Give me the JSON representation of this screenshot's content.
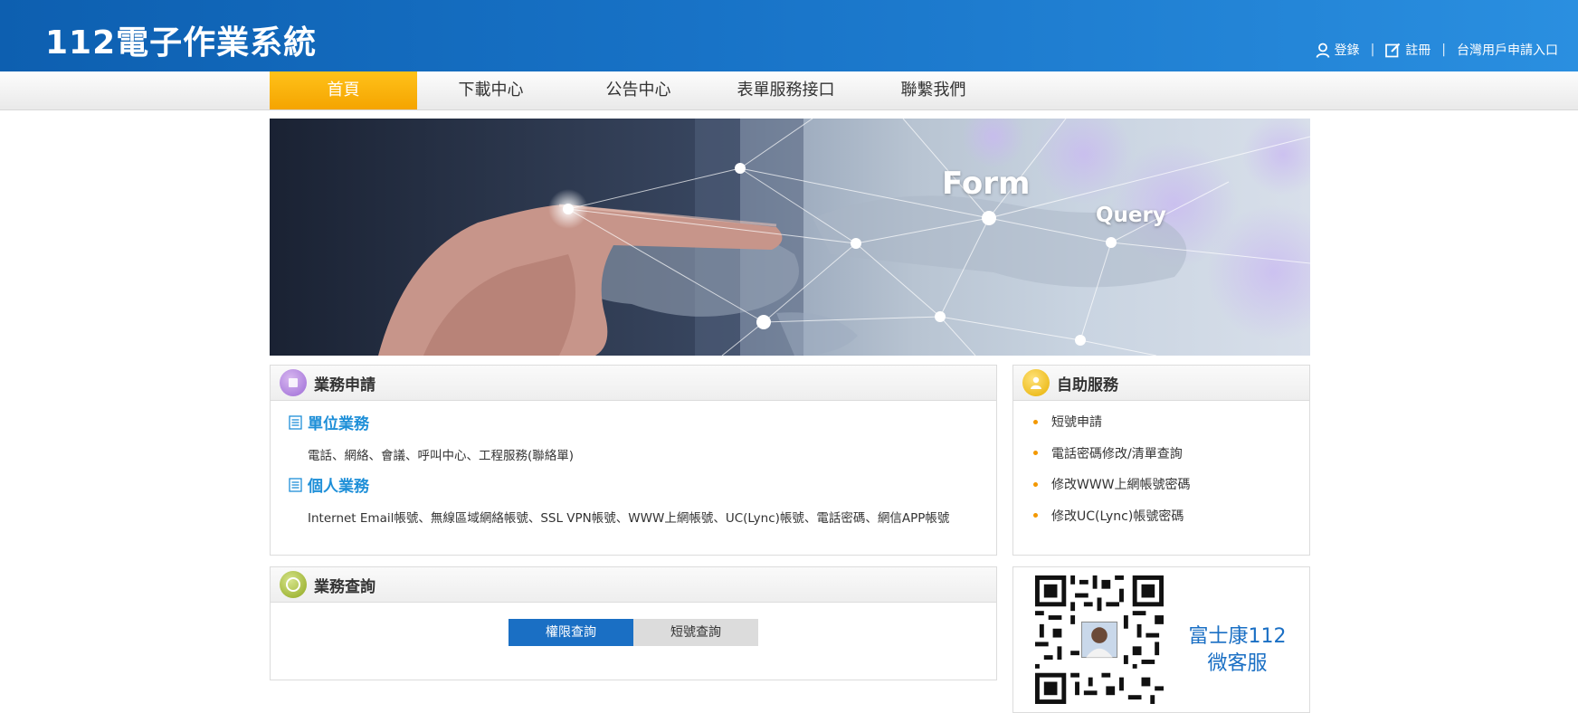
{
  "header": {
    "logo": "112電子作業系統",
    "links": {
      "login": "登錄",
      "register": "註冊",
      "taiwan": "台灣用戶申請入口"
    }
  },
  "nav": {
    "items": [
      "首頁",
      "下載中心",
      "公告中心",
      "表單服務接口",
      "聯繫我們"
    ],
    "active": 0
  },
  "banner": {
    "word1": "Form",
    "word2": "Query"
  },
  "business": {
    "title": "業務申請",
    "unit_title": "單位業務",
    "unit_desc": "電話、網絡、會議、呼叫中心、工程服務(聯絡單)",
    "personal_title": "個人業務",
    "personal_desc": "Internet Email帳號、無線區域網絡帳號、SSL VPN帳號、WWW上網帳號、UC(Lync)帳號、電話密碼、網信APP帳號"
  },
  "selfservice": {
    "title": "自助服務",
    "items": [
      "短號申請",
      "電話密碼修改/清單查詢",
      "修改WWW上網帳號密碼",
      "修改UC(Lync)帳號密碼"
    ]
  },
  "query": {
    "title": "業務查詢",
    "tab_active": "權限查詢",
    "tab_other": "短號查詢"
  },
  "wechat": {
    "line1": "富士康112",
    "line2": "微客服"
  },
  "colors": {
    "header_blue": "#1873c7",
    "active_orange": "#f5a400",
    "link_blue": "#1e8fd8",
    "button_blue": "#1a6fc4"
  }
}
